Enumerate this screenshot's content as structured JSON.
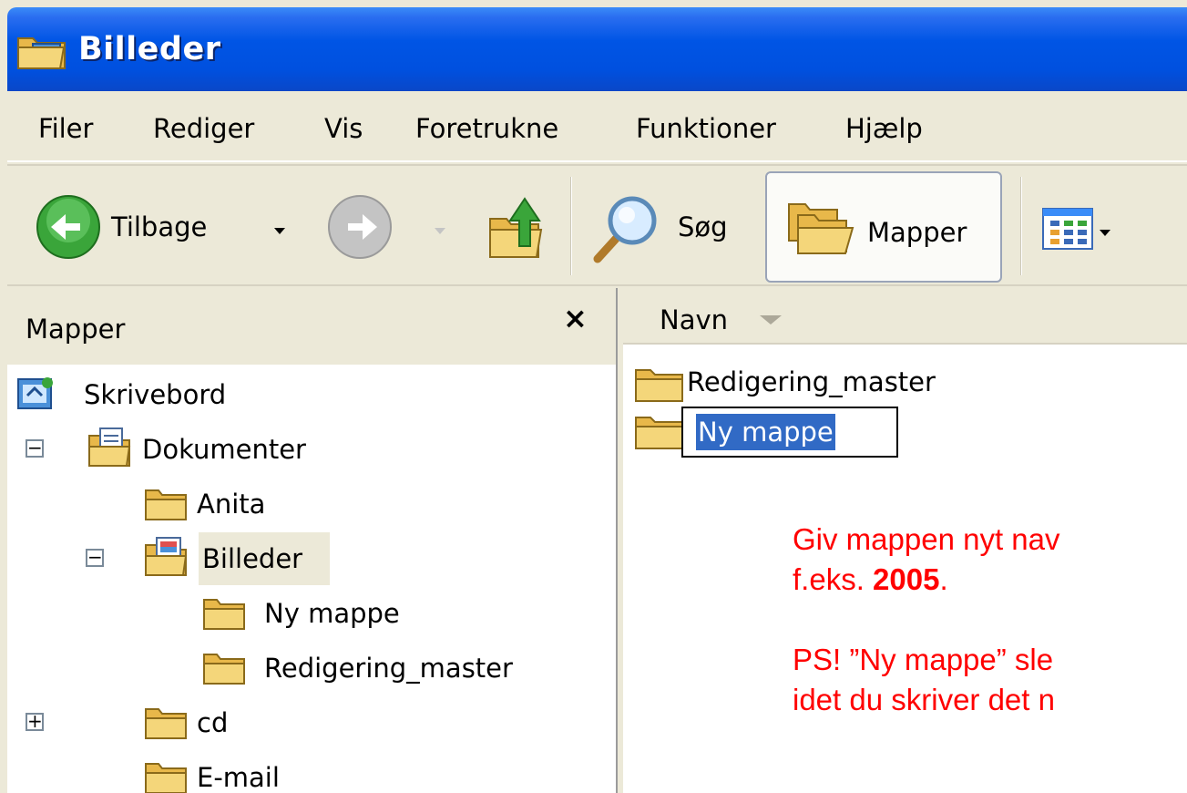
{
  "window": {
    "title": "Billeder"
  },
  "menu": [
    "Filer",
    "Rediger",
    "Vis",
    "Foretrukne",
    "Funktioner",
    "Hjælp"
  ],
  "toolbar": {
    "back_label": "Tilbage",
    "search_label": "Søg",
    "folders_label": "Mapper"
  },
  "folder_pane": {
    "title": "Mapper",
    "close_glyph": "×",
    "tree": [
      {
        "label": "Skrivebord"
      },
      {
        "label": "Dokumenter",
        "expander": "−"
      },
      {
        "label": "Anita"
      },
      {
        "label": "Billeder",
        "expander": "−",
        "selected": true
      },
      {
        "label": "Ny mappe"
      },
      {
        "label": "Redigering_master"
      },
      {
        "label": "cd",
        "expander": "+"
      },
      {
        "label": "E-mail"
      }
    ]
  },
  "content": {
    "column_header": "Navn",
    "files": [
      {
        "label": "Redigering_master"
      },
      {
        "label": "Ny mappe",
        "renaming": true
      }
    ]
  },
  "instruction": {
    "line1": "Giv mappen nyt nav",
    "line2_prefix": "f.eks. ",
    "line2_bold": "2005",
    "line2_suffix": ".",
    "line3": "PS! ”Ny mappe” sle",
    "line4": "idet du skriver det n"
  },
  "colors": {
    "title_bar": "#0055e5",
    "selection": "#316ac5",
    "instruction_text": "#ff0000"
  }
}
